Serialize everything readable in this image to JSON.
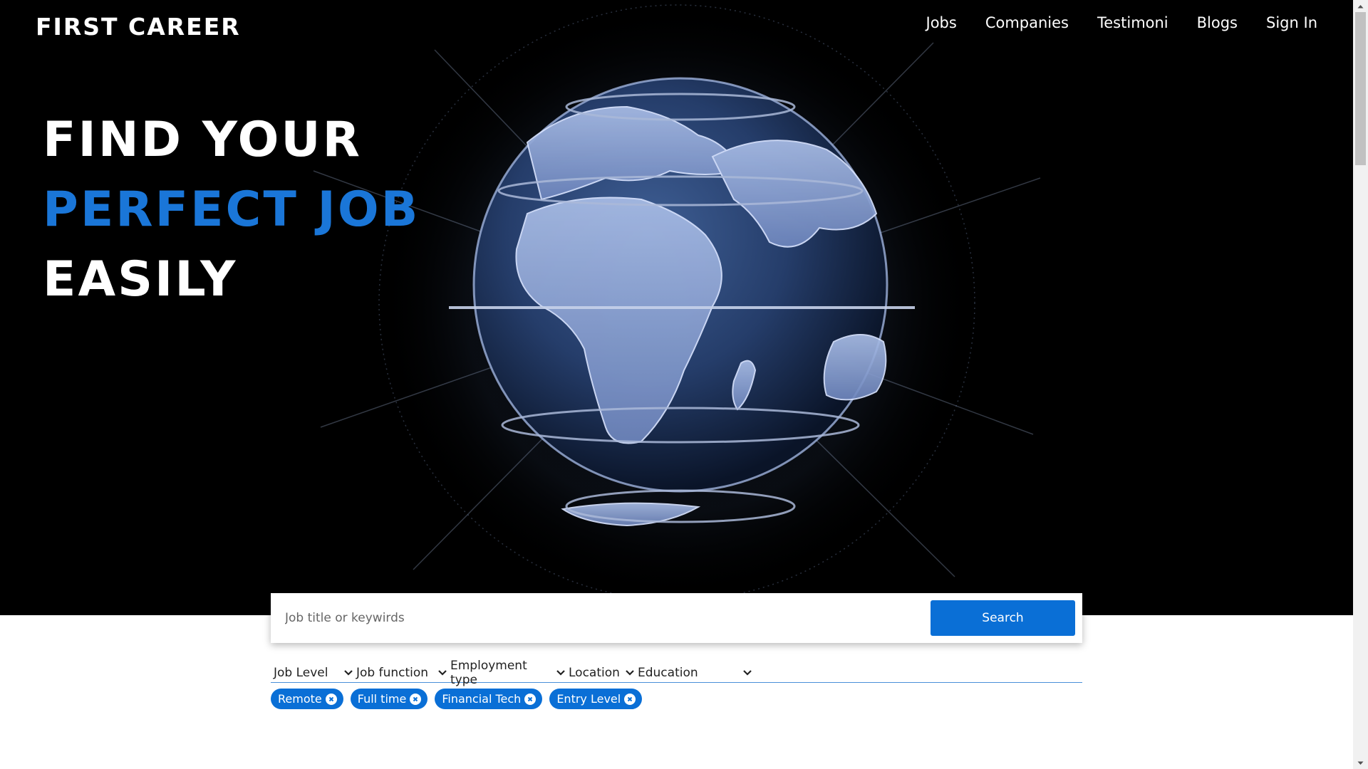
{
  "brand": {
    "name": "FIRST CAREER"
  },
  "nav": {
    "items": [
      {
        "label": "Jobs"
      },
      {
        "label": "Companies"
      },
      {
        "label": "Testimoni"
      },
      {
        "label": "Blogs"
      },
      {
        "label": "Sign In"
      }
    ]
  },
  "hero": {
    "line1": "FIND YOUR",
    "line2": "PERFECT JOB",
    "line3": "EASILY",
    "image_icon": "globe-hologram",
    "accent_color": "#1a76d8"
  },
  "search": {
    "placeholder": "Job title or keywirds",
    "value": "",
    "button_label": "Search"
  },
  "filters": [
    {
      "label": "Job Level"
    },
    {
      "label": "Job function"
    },
    {
      "label": "Employment type"
    },
    {
      "label": "Location"
    },
    {
      "label": "Education"
    }
  ],
  "chips": [
    {
      "label": "Remote"
    },
    {
      "label": "Full time"
    },
    {
      "label": "Financial Tech"
    },
    {
      "label": "Entry Level"
    }
  ],
  "colors": {
    "primary": "#0a6fd6",
    "hero_bg": "#000000"
  }
}
